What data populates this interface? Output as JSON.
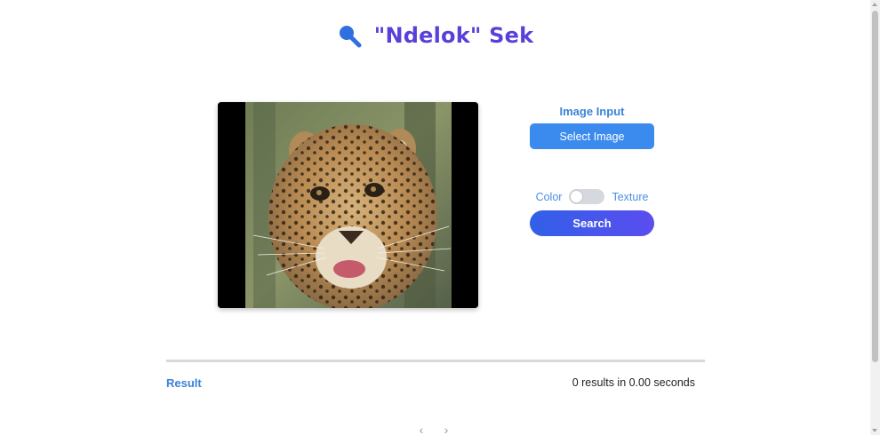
{
  "header": {
    "icon": "magnifier-icon",
    "title": "\"Ndelok\" Sek",
    "accent": "#5a3fd8",
    "icon_color": "#2f6fe0"
  },
  "preview": {
    "image": "leopard-photo"
  },
  "controls": {
    "input_label": "Image Input",
    "select_label": "Select Image",
    "toggle_left": "Color",
    "toggle_right": "Texture",
    "toggle_state": "Color",
    "search_label": "Search"
  },
  "results": {
    "label": "Result",
    "stats": "0 results in 0.00 seconds",
    "prev": "‹",
    "next": "›"
  }
}
